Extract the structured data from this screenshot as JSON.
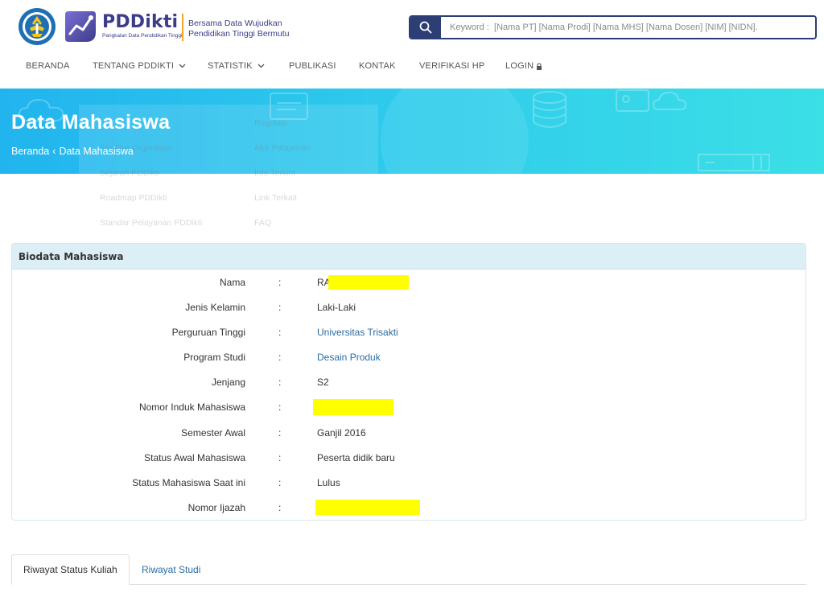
{
  "header": {
    "brand_name": "PDDikti",
    "brand_sub": "Pangkalan Data Pendidikan Tinggi",
    "tagline_line1": "Bersama Data Wujudkan",
    "tagline_line2": "Pendidikan Tinggi Bermutu",
    "search_placeholder": "Keyword :  [Nama PT] [Nama Prodi] [Nama MHS] [Nama Dosen] [NIM] [NIDN]."
  },
  "nav": {
    "items": [
      {
        "label": "BERANDA"
      },
      {
        "label": "TENTANG PDDIKTI"
      },
      {
        "label": "STATISTIK"
      },
      {
        "label": "PUBLIKASI"
      },
      {
        "label": "KONTAK"
      },
      {
        "label": "VERIFIKASI HP"
      },
      {
        "label": "LOGIN"
      }
    ]
  },
  "dropdown_ghost": {
    "col1": [
      "Struktur Organisasi",
      "Sejarah PDDikti",
      "Roadmap PDDikti",
      "Standar Pelayanan PDDikti"
    ],
    "col2": [
      "Regulasi",
      "Alur Pelaporan",
      "Info Terkini",
      "Link Terkait",
      "FAQ"
    ]
  },
  "banner": {
    "title": "Data Mahasiswa",
    "breadcrumb_home": "Beranda",
    "breadcrumb_sep": "‹",
    "breadcrumb_current": "Data Mahasiswa"
  },
  "biodata": {
    "title": "Biodata Mahasiswa",
    "separator": ":",
    "rows": [
      {
        "label": "Nama",
        "value": "RA"
      },
      {
        "label": "Jenis Kelamin",
        "value": "Laki-Laki"
      },
      {
        "label": "Perguruan Tinggi",
        "value": "Universitas Trisakti"
      },
      {
        "label": "Program Studi",
        "value": "Desain Produk"
      },
      {
        "label": "Jenjang",
        "value": "S2"
      },
      {
        "label": "Nomor Induk Mahasiswa",
        "value": ""
      },
      {
        "label": "Semester Awal",
        "value": "Ganjil 2016"
      },
      {
        "label": "Status Awal Mahasiswa",
        "value": "Peserta didik baru"
      },
      {
        "label": "Status Mahasiswa Saat ini",
        "value": "Lulus"
      },
      {
        "label": "Nomor Ijazah",
        "value": ""
      }
    ]
  },
  "tabs": [
    {
      "label": "Riwayat Status Kuliah"
    },
    {
      "label": "Riwayat Studi"
    }
  ],
  "colors": {
    "brand_navy": "#2c3e73",
    "banner_start": "#21b4ee",
    "banner_end": "#3bdfe6",
    "link": "#2b6ca3",
    "redaction": "#ffff00"
  }
}
